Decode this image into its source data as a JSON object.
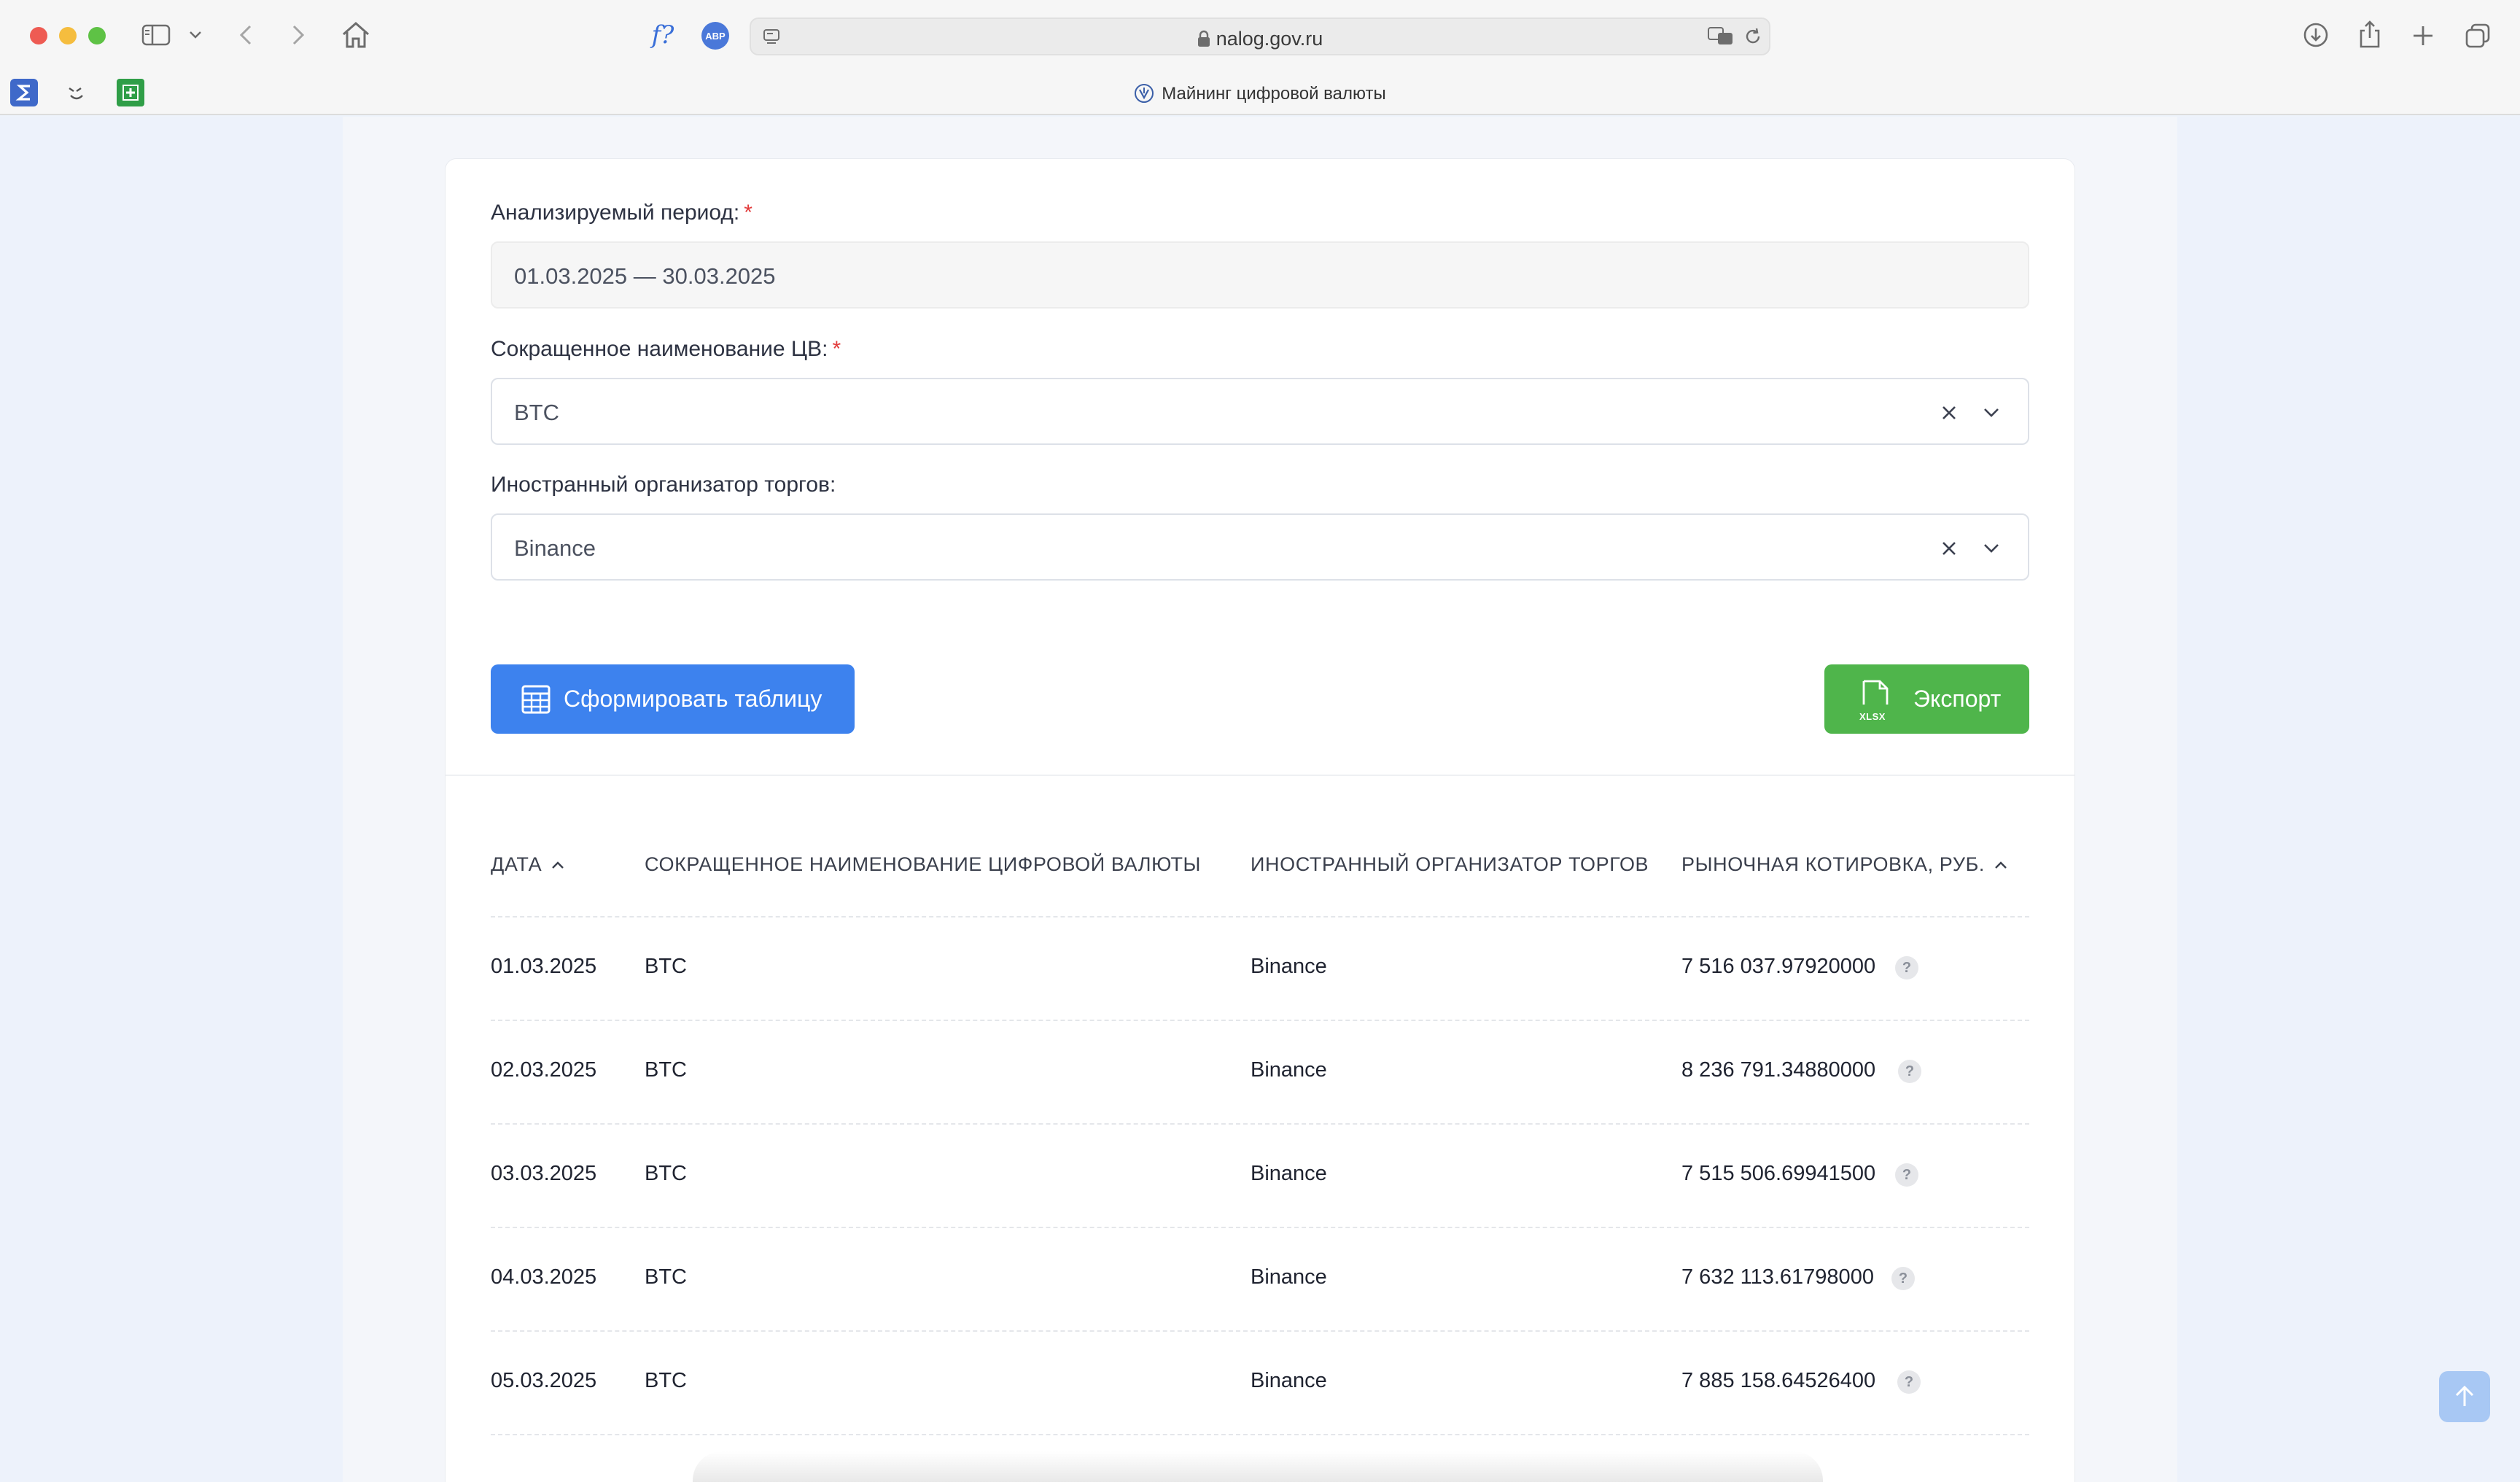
{
  "browser": {
    "url": "nalog.gov.ru",
    "tab_title": "Майнинг цифровой валюты",
    "abp_label": "ABP",
    "f_label": "f?"
  },
  "form": {
    "period_label": "Анализируемый период:",
    "period_value": "01.03.2025 — 30.03.2025",
    "currency_label": "Сокращенное наименование ЦВ:",
    "currency_value": "BTC",
    "organizer_label": "Иностранный организатор торгов:",
    "organizer_value": "Binance",
    "required_mark": "*",
    "generate_button": "Сформировать таблицу",
    "export_button": "Экспорт",
    "export_file_type": "XLSX"
  },
  "table": {
    "headers": {
      "date": "ДАТА",
      "currency": "СОКРАЩЕННОЕ НАИМЕНОВАНИЕ ЦИФРОВОЙ ВАЛЮТЫ",
      "organizer": "ИНОСТРАННЫЙ ОРГАНИЗАТОР ТОРГОВ",
      "quote": "РЫНОЧНАЯ КОТИРОВКА, РУБ."
    },
    "help_glyph": "?",
    "rows": [
      {
        "date": "01.03.2025",
        "currency": "BTC",
        "organizer": "Binance",
        "quote": "7 516 037.97920000"
      },
      {
        "date": "02.03.2025",
        "currency": "BTC",
        "organizer": "Binance",
        "quote": "8 236 791.34880000"
      },
      {
        "date": "03.03.2025",
        "currency": "BTC",
        "organizer": "Binance",
        "quote": "7 515 506.69941500"
      },
      {
        "date": "04.03.2025",
        "currency": "BTC",
        "organizer": "Binance",
        "quote": "7 632 113.61798000"
      },
      {
        "date": "05.03.2025",
        "currency": "BTC",
        "organizer": "Binance",
        "quote": "7 885 158.64526400"
      }
    ]
  },
  "colors": {
    "primary_button": "#3d82ee",
    "export_button": "#4fb54b",
    "required": "#e23b3b"
  }
}
